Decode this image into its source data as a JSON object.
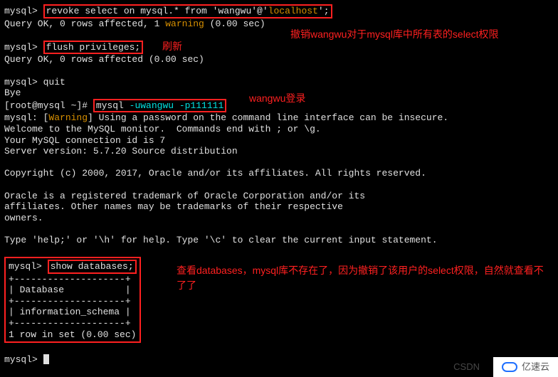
{
  "lines": {
    "l1_prompt": "mysql> ",
    "l1_cmd_pre": "revoke select on mysql.* from 'wangwu'@'",
    "l1_cmd_host": "localhost",
    "l1_cmd_post": "';",
    "l2": "Query OK, 0 rows affected, 1 ",
    "l2_warn": "warning",
    "l2_tail": " (0.00 sec)",
    "l3_prompt": "mysql> ",
    "l3_cmd": "flush privileges;",
    "l4": "Query OK, 0 rows affected (0.00 sec)",
    "l5": "mysql> quit",
    "l6": "Bye",
    "l7_pre": "[root@mysql ~]# ",
    "l7_mid": "mysql ",
    "l7_flags": "-uwangwu -p111111",
    "l8_pre": "mysql: [",
    "l8_warn": "Warning",
    "l8_post": "] Using a password on the command line interface can be insecure.",
    "l9": "Welcome to the MySQL monitor.  Commands end with ; or \\g.",
    "l10": "Your MySQL connection id is 7",
    "l11": "Server version: 5.7.20 Source distribution",
    "l12": "Copyright (c) 2000, 2017, Oracle and/or its affiliates. All rights reserved.",
    "l13": "Oracle is a registered trademark of Oracle Corporation and/or its",
    "l14": "affiliates. Other names may be trademarks of their respective",
    "l15": "owners.",
    "l16": "Type 'help;' or '\\h' for help. Type '\\c' to clear the current input statement.",
    "l17_prompt": "mysql> ",
    "l17_cmd": "show databases;",
    "tbl_sep": "+--------------------+",
    "tbl_head": "| Database           |",
    "tbl_row": "| information_schema |",
    "tbl_foot": "1 row in set (0.00 sec)",
    "last_prompt": "mysql> "
  },
  "annotations": {
    "a1": "撤销wangwu对于mysql库中所有表的select权限",
    "a2": "刷新",
    "a3": "wangwu登录",
    "a4": "查看databases，mysql库不存在了，因为撤销了该用户的select权限，自然就查看不了了"
  },
  "watermark": {
    "csdn": "CSDN",
    "yisu": "亿速云"
  }
}
